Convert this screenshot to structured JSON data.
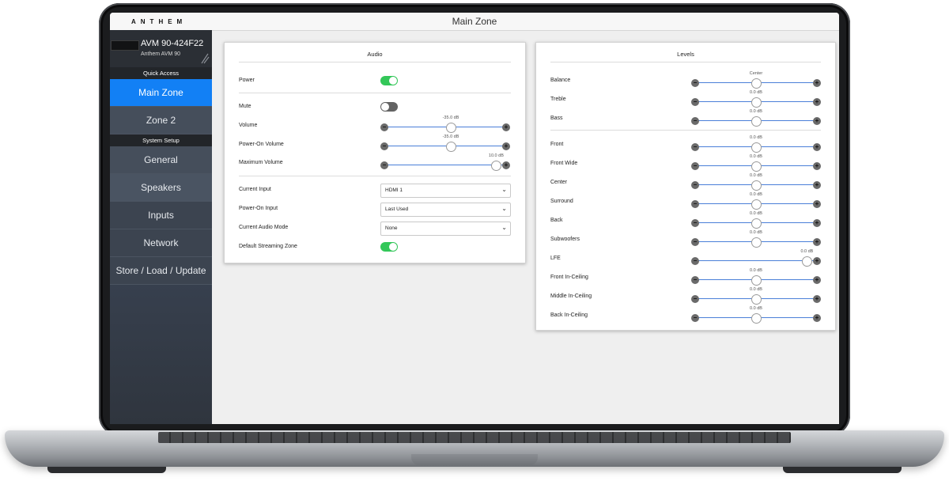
{
  "app": {
    "logo": "ANTHEM",
    "title": "Main Zone"
  },
  "device": {
    "name": "AVM 90-424F22",
    "model": "Anthem AVM 90"
  },
  "sidebar": {
    "quick_access_label": "Quick Access",
    "system_setup_label": "System Setup",
    "items": [
      {
        "label": "Main Zone"
      },
      {
        "label": "Zone 2"
      },
      {
        "label": "General"
      },
      {
        "label": "Speakers"
      },
      {
        "label": "Inputs"
      },
      {
        "label": "Network"
      },
      {
        "label": "Store / Load / Update"
      }
    ],
    "active_item": "Main Zone"
  },
  "audio": {
    "title": "Audio",
    "power": {
      "label": "Power",
      "on": true
    },
    "mute": {
      "label": "Mute",
      "on": false
    },
    "volume": {
      "label": "Volume",
      "value": "-35.0 dB",
      "level": 0.55
    },
    "power_on_volume": {
      "label": "Power-On Volume",
      "value": "-35.0 dB",
      "level": 0.55
    },
    "maximum_volume": {
      "label": "Maximum Volume",
      "value": "10.0 dB",
      "level": 0.96
    },
    "current_input": {
      "label": "Current Input",
      "value": "HDMI 1"
    },
    "power_on_input": {
      "label": "Power-On Input",
      "value": "Last Used"
    },
    "current_audio_mode": {
      "label": "Current Audio Mode",
      "value": "None"
    },
    "default_streaming_zone": {
      "label": "Default Streaming Zone",
      "on": true
    }
  },
  "levels": {
    "title": "Levels",
    "rows": [
      {
        "label": "Balance",
        "value": "Center",
        "level": 0.5
      },
      {
        "label": "Treble",
        "value": "0.0 dB",
        "level": 0.5
      },
      {
        "label": "Bass",
        "value": "0.0 dB",
        "level": 0.5
      },
      {
        "label": "Front",
        "value": "0.0 dB",
        "level": 0.5
      },
      {
        "label": "Front Wide",
        "value": "0.0 dB",
        "level": 0.5
      },
      {
        "label": "Center",
        "value": "0.0 dB",
        "level": 0.5
      },
      {
        "label": "Surround",
        "value": "0.0 dB",
        "level": 0.5
      },
      {
        "label": "Back",
        "value": "0.0 dB",
        "level": 0.5
      },
      {
        "label": "Subwoofers",
        "value": "0.0 dB",
        "level": 0.5
      },
      {
        "label": "LFE",
        "value": "0.0 dB",
        "level": 0.96
      },
      {
        "label": "Front In-Ceiling",
        "value": "0.0 dB",
        "level": 0.5
      },
      {
        "label": "Middle In-Ceiling",
        "value": "0.0 dB",
        "level": 0.5
      },
      {
        "label": "Back In-Ceiling",
        "value": "0.0 dB",
        "level": 0.5
      }
    ]
  },
  "colors": {
    "accent": "#1280f5",
    "toggle_on": "#33c759",
    "slider_track": "#4a7fd8"
  }
}
